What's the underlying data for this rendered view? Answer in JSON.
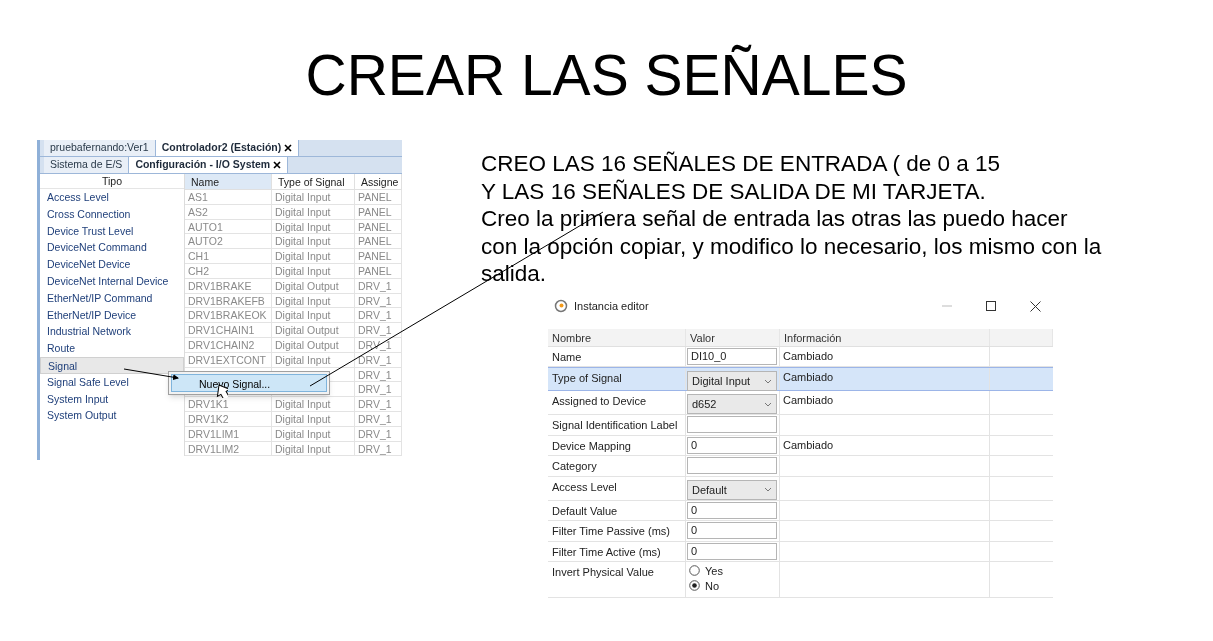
{
  "title": "CREAR LAS SEÑALES",
  "screenshot": {
    "tabs": [
      {
        "label": "pruebafernando:Ver1",
        "selected": false,
        "closable": false
      },
      {
        "label": "Controlador2 (Estación)",
        "selected": true,
        "closable": true
      }
    ],
    "subtabs": [
      {
        "label": "Sistema de E/S",
        "selected": false,
        "closable": false
      },
      {
        "label": "Configuración - I/O System",
        "selected": true,
        "closable": true
      }
    ],
    "tipo_header": "Tipo",
    "tipo_items": [
      {
        "label": "Access Level",
        "selected": false
      },
      {
        "label": "Cross Connection",
        "selected": false
      },
      {
        "label": "Device Trust Level",
        "selected": false
      },
      {
        "label": "DeviceNet Command",
        "selected": false
      },
      {
        "label": "DeviceNet Device",
        "selected": false
      },
      {
        "label": "DeviceNet Internal Device",
        "selected": false
      },
      {
        "label": "EtherNet/IP Command",
        "selected": false
      },
      {
        "label": "EtherNet/IP Device",
        "selected": false
      },
      {
        "label": "Industrial Network",
        "selected": false
      },
      {
        "label": "Route",
        "selected": false
      },
      {
        "label": "Signal",
        "selected": true
      },
      {
        "label": "Signal Safe Level",
        "selected": false
      },
      {
        "label": "System Input",
        "selected": false
      },
      {
        "label": "System Output",
        "selected": false
      }
    ],
    "columns": [
      "Name",
      "Type of Signal",
      "Assigne"
    ],
    "rows": [
      {
        "name": "AS1",
        "type": "Digital Input",
        "assigned": "PANEL"
      },
      {
        "name": "AS2",
        "type": "Digital Input",
        "assigned": "PANEL"
      },
      {
        "name": "AUTO1",
        "type": "Digital Input",
        "assigned": "PANEL"
      },
      {
        "name": "AUTO2",
        "type": "Digital Input",
        "assigned": "PANEL"
      },
      {
        "name": "CH1",
        "type": "Digital Input",
        "assigned": "PANEL"
      },
      {
        "name": "CH2",
        "type": "Digital Input",
        "assigned": "PANEL"
      },
      {
        "name": "DRV1BRAKE",
        "type": "Digital Output",
        "assigned": "DRV_1"
      },
      {
        "name": "DRV1BRAKEFB",
        "type": "Digital Input",
        "assigned": "DRV_1"
      },
      {
        "name": "DRV1BRAKEOK",
        "type": "Digital Input",
        "assigned": "DRV_1"
      },
      {
        "name": "DRV1CHAIN1",
        "type": "Digital Output",
        "assigned": "DRV_1"
      },
      {
        "name": "DRV1CHAIN2",
        "type": "Digital Output",
        "assigned": "DRV_1"
      },
      {
        "name": "DRV1EXTCONT",
        "type": "Digital Input",
        "assigned": "DRV_1"
      },
      {
        "assigned": "DRV_1"
      },
      {
        "assigned": "DRV_1"
      },
      {
        "name": "DRV1K1",
        "type": "Digital Input",
        "assigned": "DRV_1"
      },
      {
        "name": "DRV1K2",
        "type": "Digital Input",
        "assigned": "DRV_1"
      },
      {
        "name": "DRV1LIM1",
        "type": "Digital Input",
        "assigned": "DRV_1"
      },
      {
        "name": "DRV1LIM2",
        "type": "Digital Input",
        "assigned": "DRV_1"
      }
    ],
    "context_menu": [
      {
        "label": "Nuevo Signal...",
        "selected": true
      }
    ]
  },
  "description": [
    "CREO LAS 16 SEÑALES DE ENTRADA ( de 0 a 15",
    "Y LAS 16 SEÑALES DE SALIDA DE MI TARJETA.",
    "Creo la primera señal de entrada las otras las puedo hacer",
    "con la opción copiar, y modifico lo necesario, los mismo con la",
    "salida."
  ],
  "editor": {
    "title": "Instancia editor",
    "columns": [
      "Nombre",
      "Valor",
      "Información"
    ],
    "rows": [
      {
        "kind": "text",
        "label": "Name",
        "value": "DI10_0",
        "info": "Cambiado",
        "selected": false
      },
      {
        "kind": "select",
        "label": "Type of Signal",
        "value": "Digital Input",
        "info": "Cambiado",
        "selected": true
      },
      {
        "kind": "select",
        "label": "Assigned to Device",
        "value": "d652",
        "info": "Cambiado",
        "selected": false
      },
      {
        "kind": "text",
        "label": "Signal Identification Label",
        "selected": false
      },
      {
        "kind": "text",
        "label": "Device Mapping",
        "value": "0",
        "info": "Cambiado",
        "selected": false
      },
      {
        "kind": "text",
        "label": "Category",
        "selected": false
      },
      {
        "kind": "select",
        "label": "Access Level",
        "value": "Default",
        "selected": false
      },
      {
        "kind": "text",
        "label": "Default Value",
        "value": "0",
        "selected": false
      },
      {
        "kind": "text",
        "label": "Filter Time Passive (ms)",
        "value": "0",
        "selected": false
      },
      {
        "kind": "text",
        "label": "Filter Time Active (ms)",
        "value": "0",
        "selected": false
      },
      {
        "kind": "radio",
        "label": "Invert Physical Value",
        "options": [
          {
            "label": "Yes",
            "selected": false
          },
          {
            "label": "No",
            "selected": true
          }
        ],
        "selected": false
      }
    ]
  }
}
